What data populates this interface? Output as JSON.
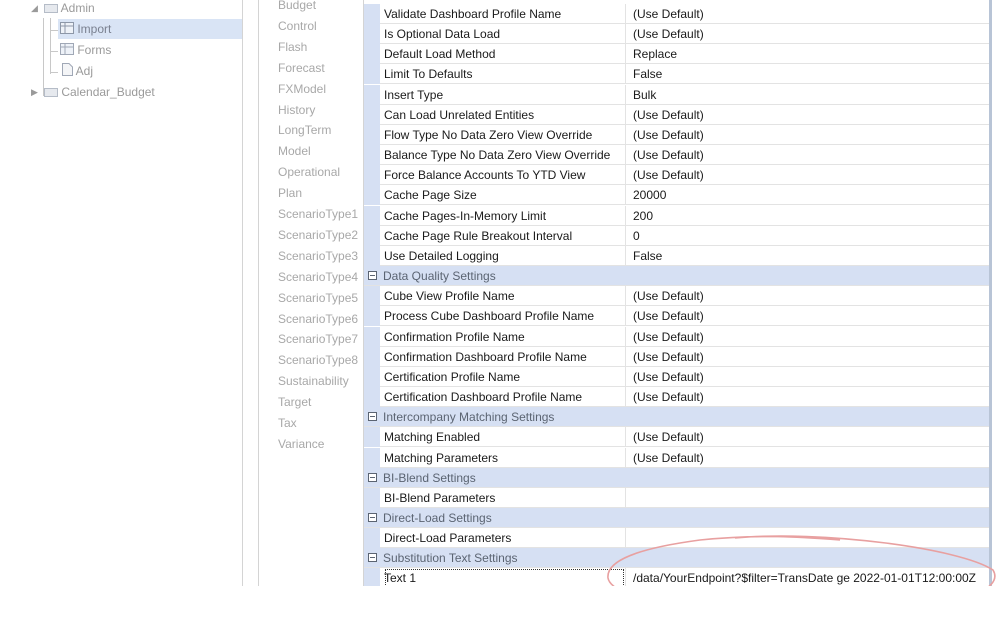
{
  "tree": {
    "items": [
      {
        "label": "Admin"
      },
      {
        "label": "Import"
      },
      {
        "label": "Forms"
      },
      {
        "label": "Adj"
      },
      {
        "label": "Calendar_Budget"
      }
    ]
  },
  "scenario_types": [
    "Budget",
    "Control",
    "Flash",
    "Forecast",
    "FXModel",
    "History",
    "LongTerm",
    "Model",
    "Operational",
    "Plan",
    "ScenarioType1",
    "ScenarioType2",
    "ScenarioType3",
    "ScenarioType4",
    "ScenarioType5",
    "ScenarioType6",
    "ScenarioType7",
    "ScenarioType8",
    "Sustainability",
    "Target",
    "Tax",
    "Variance"
  ],
  "properties": [
    {
      "name": "Validate Dashboard Profile Name",
      "value": "(Use Default)"
    },
    {
      "name": "Is Optional Data Load",
      "value": "(Use Default)"
    },
    {
      "name": "Default Load Method",
      "value": "Replace"
    },
    {
      "name": "Limit To Defaults",
      "value": "False"
    },
    {
      "name": "Insert Type",
      "value": "Bulk"
    },
    {
      "name": "Can Load Unrelated Entities",
      "value": "(Use Default)"
    },
    {
      "name": "Flow Type No Data Zero View Override",
      "value": "(Use Default)"
    },
    {
      "name": "Balance Type No Data Zero View Override",
      "value": "(Use Default)"
    },
    {
      "name": "Force Balance Accounts To YTD View",
      "value": "(Use Default)"
    },
    {
      "name": "Cache Page Size",
      "value": "20000"
    },
    {
      "name": "Cache Pages-In-Memory Limit",
      "value": "200"
    },
    {
      "name": "Cache Page Rule Breakout Interval",
      "value": "0"
    },
    {
      "name": "Use Detailed Logging",
      "value": "False"
    },
    {
      "category": "Data Quality Settings"
    },
    {
      "name": "Cube View Profile Name",
      "value": "(Use Default)"
    },
    {
      "name": "Process Cube Dashboard Profile Name",
      "value": "(Use Default)"
    },
    {
      "name": "Confirmation Profile Name",
      "value": "(Use Default)"
    },
    {
      "name": "Confirmation Dashboard Profile Name",
      "value": "(Use Default)"
    },
    {
      "name": "Certification Profile Name",
      "value": "(Use Default)"
    },
    {
      "name": "Certification Dashboard Profile Name",
      "value": "(Use Default)"
    },
    {
      "category": "Intercompany Matching Settings"
    },
    {
      "name": "Matching Enabled",
      "value": "(Use Default)"
    },
    {
      "name": "Matching Parameters",
      "value": "(Use Default)"
    },
    {
      "category": "BI-Blend Settings"
    },
    {
      "name": "BI-Blend Parameters",
      "value": ""
    },
    {
      "category": "Direct-Load Settings"
    },
    {
      "name": "Direct-Load Parameters",
      "value": ""
    },
    {
      "category": "Substitution Text Settings"
    },
    {
      "name": "Text 1",
      "value": "/data/YourEndpoint?$filter=TransDate ge 2022-01-01T12:00:00Z",
      "focused": true
    }
  ],
  "colors": {
    "category_bg": "#d6e0f3",
    "annotation": "#e8a0a0"
  }
}
